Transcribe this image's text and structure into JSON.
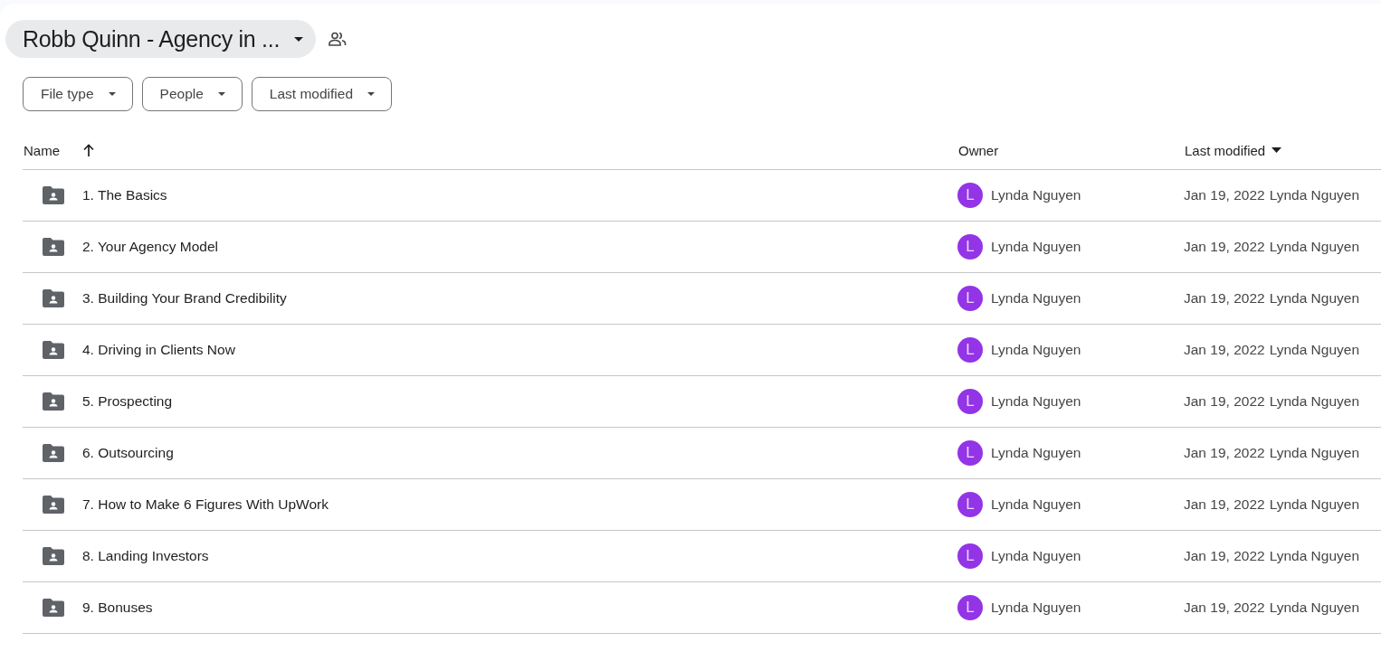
{
  "folder_title": "Robb Quinn - Agency in ...",
  "filters": [
    "File type",
    "People",
    "Last modified"
  ],
  "columns": {
    "name": "Name",
    "owner": "Owner",
    "modified": "Last modified"
  },
  "rows": [
    {
      "name": "1. The Basics",
      "owner_initial": "L",
      "owner": "Lynda Nguyen",
      "modified_date": "Jan 19, 2022",
      "modified_by": "Lynda Nguyen"
    },
    {
      "name": "2. Your Agency Model",
      "owner_initial": "L",
      "owner": "Lynda Nguyen",
      "modified_date": "Jan 19, 2022",
      "modified_by": "Lynda Nguyen"
    },
    {
      "name": "3. Building Your Brand Credibility",
      "owner_initial": "L",
      "owner": "Lynda Nguyen",
      "modified_date": "Jan 19, 2022",
      "modified_by": "Lynda Nguyen"
    },
    {
      "name": "4. Driving in Clients Now",
      "owner_initial": "L",
      "owner": "Lynda Nguyen",
      "modified_date": "Jan 19, 2022",
      "modified_by": "Lynda Nguyen"
    },
    {
      "name": "5. Prospecting",
      "owner_initial": "L",
      "owner": "Lynda Nguyen",
      "modified_date": "Jan 19, 2022",
      "modified_by": "Lynda Nguyen"
    },
    {
      "name": "6. Outsourcing",
      "owner_initial": "L",
      "owner": "Lynda Nguyen",
      "modified_date": "Jan 19, 2022",
      "modified_by": "Lynda Nguyen"
    },
    {
      "name": "7. How to Make 6 Figures With UpWork",
      "owner_initial": "L",
      "owner": "Lynda Nguyen",
      "modified_date": "Jan 19, 2022",
      "modified_by": "Lynda Nguyen"
    },
    {
      "name": "8. Landing Investors",
      "owner_initial": "L",
      "owner": "Lynda Nguyen",
      "modified_date": "Jan 19, 2022",
      "modified_by": "Lynda Nguyen"
    },
    {
      "name": "9. Bonuses",
      "owner_initial": "L",
      "owner": "Lynda Nguyen",
      "modified_date": "Jan 19, 2022",
      "modified_by": "Lynda Nguyen"
    }
  ]
}
